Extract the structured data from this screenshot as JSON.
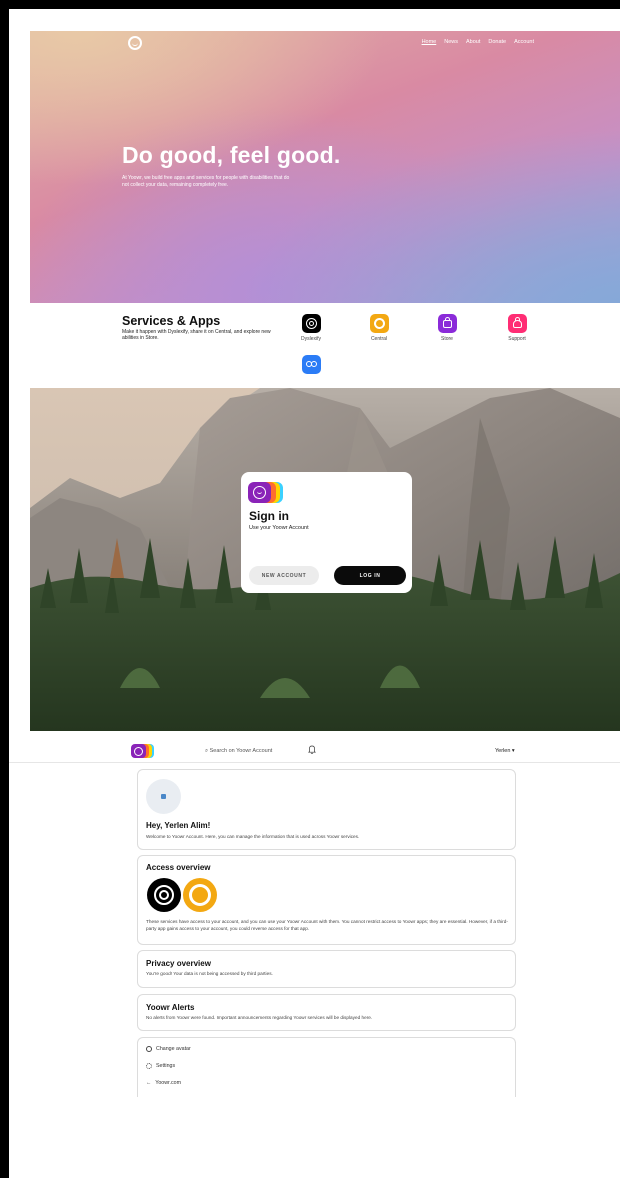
{
  "hero": {
    "nav": [
      "Home",
      "News",
      "About",
      "Donate",
      "Account"
    ],
    "active_nav": "Home",
    "title": "Do good, feel good.",
    "description": "At Yoowr, we build free apps and services for people with disabilities that do not collect your data, remaining completely free."
  },
  "services": {
    "title": "Services & Apps",
    "description": "Make it happen with Dyslexify, share it on Central, and explore new abilities in Store.",
    "apps": [
      {
        "label": "Dyslexify",
        "icon": "dyslexify-icon",
        "color": "#000000"
      },
      {
        "label": "Central",
        "icon": "central-icon",
        "color": "#f3a812"
      },
      {
        "label": "Store",
        "icon": "store-icon",
        "color": "#8b2bd9"
      },
      {
        "label": "Support",
        "icon": "support-icon",
        "color": "#ff2d74"
      },
      {
        "label": "",
        "icon": "infinity-icon",
        "color": "#2b7cf6"
      }
    ]
  },
  "signin": {
    "title": "Sign in",
    "subtitle": "Use your Yoowr Account",
    "new_account": "NEW ACCOUNT",
    "login": "LOG IN"
  },
  "account": {
    "search_placeholder": "Search on Yoowr Account",
    "user": "Yerlen",
    "greeting_title": "Hey, Yerlen Alim!",
    "greeting_text": "Welcome to Yoowr Account. Here, you can manage the information that is used across Yoowr services.",
    "access_title": "Access overview",
    "access_text": "These services have access to your account, and you can use your Yoowr Account with them. You cannot restrict access to Yoowr apps; they are essential. However, if a third-party app gains access to your account, you could reverse access for that app.",
    "privacy_title": "Privacy overview",
    "privacy_text": "You're good! Your data is not being accessed by third parties.",
    "alerts_title": "Yoowr Alerts",
    "alerts_text": "No alerts from Yoowr were found. Important announcements regarding Yoowr services will be displayed here.",
    "menu": [
      "Change avatar",
      "Settings",
      "Yoowr.com"
    ]
  },
  "colors": {
    "brand_purple": "#8a23b8",
    "brand_orange": "#ff6d2e",
    "brand_yellow": "#ffd400",
    "brand_cyan": "#3bd1ff"
  }
}
